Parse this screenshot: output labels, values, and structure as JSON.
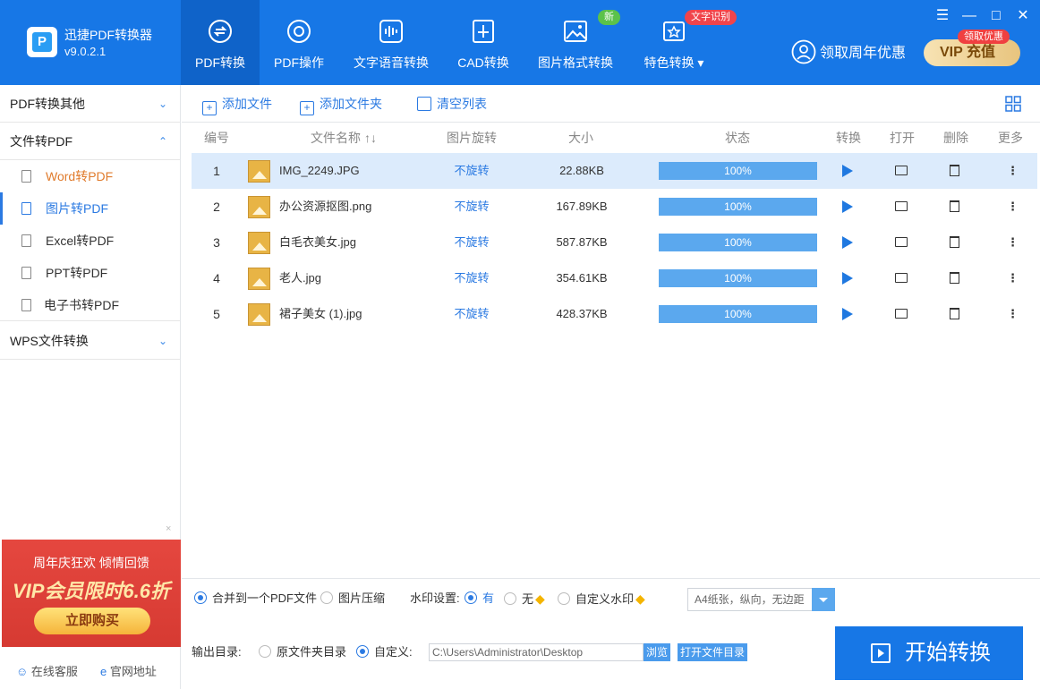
{
  "app": {
    "title": "迅捷PDF转换器",
    "version": "v9.0.2.1"
  },
  "nav": {
    "tabs": [
      {
        "label": "PDF转换",
        "icon": "pdf-convert-icon"
      },
      {
        "label": "PDF操作",
        "icon": "pdf-operation-icon"
      },
      {
        "label": "文字语音转换",
        "icon": "audio-wave-icon"
      },
      {
        "label": "CAD转换",
        "icon": "cad-icon"
      },
      {
        "label": "图片格式转换",
        "icon": "image-icon"
      },
      {
        "label": "特色转换",
        "icon": "feature-icon"
      }
    ],
    "badge_new": "新",
    "badge_ocr": "文字识别",
    "promo_text": "领取周年优惠",
    "vip_tag": "领取优惠",
    "vip_label": "VIP 充值",
    "win_controls": {
      "menu": "☰",
      "minimize": "—",
      "maximize": "□",
      "close": "✕"
    }
  },
  "sidebar": {
    "groups": [
      {
        "label": "PDF转换其他",
        "chevron": "⌄"
      },
      {
        "label": "文件转PDF",
        "chevron": "⌃"
      },
      {
        "label": "WPS文件转换",
        "chevron": "⌄"
      }
    ],
    "items": [
      {
        "label": "Word转PDF",
        "icon": "word-file-icon"
      },
      {
        "label": "图片转PDF",
        "icon": "image-file-icon"
      },
      {
        "label": "Excel转PDF",
        "icon": "excel-file-icon"
      },
      {
        "label": "PPT转PDF",
        "icon": "ppt-file-icon"
      },
      {
        "label": "电子书转PDF",
        "icon": "ebook-file-icon"
      }
    ],
    "ad": {
      "line1": "周年庆狂欢 倾情回馈",
      "line2": "VIP会员限时6.6折",
      "button": "立即购买",
      "close": "×"
    },
    "footer": {
      "service": "在线客服",
      "website": "官网地址"
    }
  },
  "toolbar": {
    "add_file": "添加文件",
    "add_folder": "添加文件夹",
    "clear_list": "清空列表"
  },
  "table": {
    "headers": {
      "num": "编号",
      "name": "文件名称",
      "rotate": "图片旋转",
      "size": "大小",
      "status": "状态",
      "convert": "转换",
      "open": "打开",
      "delete": "删除",
      "more": "更多"
    },
    "rows": [
      {
        "num": "1",
        "name": "IMG_2249.JPG",
        "rotate": "不旋转",
        "size": "22.88KB",
        "progress": "100%"
      },
      {
        "num": "2",
        "name": "办公资源抠图.png",
        "rotate": "不旋转",
        "size": "167.89KB",
        "progress": "100%"
      },
      {
        "num": "3",
        "name": "白毛衣美女.jpg",
        "rotate": "不旋转",
        "size": "587.87KB",
        "progress": "100%"
      },
      {
        "num": "4",
        "name": "老人.jpg",
        "rotate": "不旋转",
        "size": "354.61KB",
        "progress": "100%"
      },
      {
        "num": "5",
        "name": "裙子美女 (1).jpg",
        "rotate": "不旋转",
        "size": "428.37KB",
        "progress": "100%"
      }
    ]
  },
  "settings": {
    "merge_label": "合并到一个PDF文件",
    "compress_label": "图片压缩",
    "watermark_label": "水印设置:",
    "wm_yes": "有",
    "wm_no": "无",
    "wm_custom": "自定义水印",
    "page_select": "A4纸张，纵向，无边距",
    "output_label": "输出目录:",
    "out_source": "原文件夹目录",
    "out_custom": "自定义:",
    "path": "C:\\Users\\Administrator\\Desktop",
    "browse": "浏览",
    "open_dir": "打开文件目录",
    "start": "开始转换"
  },
  "colors": {
    "brand": "#1777e6",
    "progress": "#5ba8ee",
    "accent_orange": "#e07b2c"
  }
}
